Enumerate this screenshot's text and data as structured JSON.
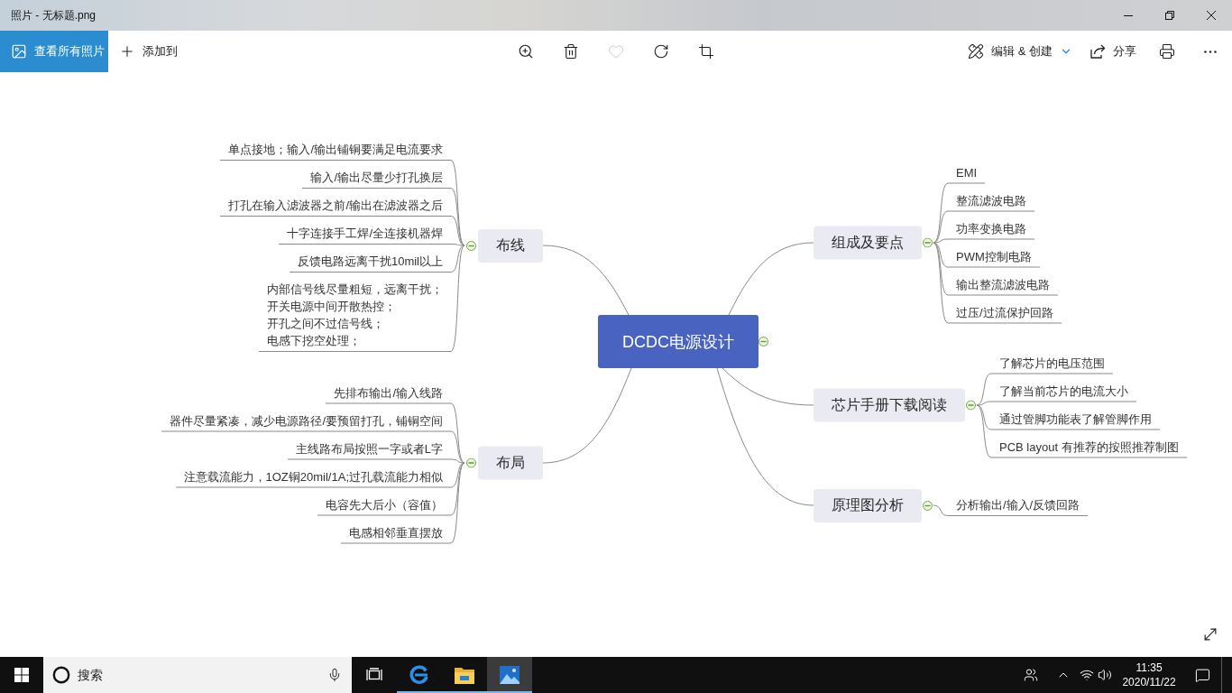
{
  "window": {
    "title": "照片 - 无标题.png"
  },
  "toolbar": {
    "view_all": "查看所有照片",
    "add_to": "添加到",
    "tools": [
      {
        "kind": "zoom",
        "disabled": false
      },
      {
        "kind": "delete",
        "disabled": false
      },
      {
        "kind": "favorite",
        "disabled": true
      },
      {
        "kind": "rotate",
        "disabled": false
      },
      {
        "kind": "crop",
        "disabled": false
      }
    ],
    "edit_create": "编辑 & 创建",
    "share": "分享"
  },
  "mindmap": {
    "central": {
      "label": "DCDC电源设计",
      "expanded": true
    },
    "left_branches": [
      {
        "label": "布线",
        "expanded": true,
        "children": [
          {
            "label": "单点接地；输入/输出铺铜要满足电流要求"
          },
          {
            "label": "输入/输出尽量少打孔换层"
          },
          {
            "label": "打孔在输入滤波器之前/输出在滤波器之后"
          },
          {
            "label": "十字连接手工焊/全连接机器焊"
          },
          {
            "label": "反馈电路远离干扰10mil以上"
          },
          {
            "lines": [
              "内部信号线尽量粗短，远离干扰；",
              "开关电源中间开散热控；",
              "开孔之间不过信号线；",
              "电感下挖空处理；"
            ]
          }
        ]
      },
      {
        "label": "布局",
        "expanded": true,
        "children": [
          {
            "label": "先排布输出/输入线路"
          },
          {
            "label": "器件尽量紧凑，减少电源路径/要预留打孔，铺铜空间"
          },
          {
            "label": "主线路布局按照一字或者L字"
          },
          {
            "label": "注意载流能力，1OZ铜20mil/1A;过孔载流能力相似"
          },
          {
            "label": "电容先大后小（容值）"
          },
          {
            "label": "电感相邻垂直摆放"
          }
        ]
      }
    ],
    "right_branches": [
      {
        "label": "组成及要点",
        "expanded": true,
        "children": [
          {
            "label": "EMI"
          },
          {
            "label": "整流滤波电路"
          },
          {
            "label": "功率变换电路"
          },
          {
            "label": "PWM控制电路"
          },
          {
            "label": "输出整流滤波电路"
          },
          {
            "label": "过压/过流保护回路"
          }
        ]
      },
      {
        "label": "芯片手册下载阅读",
        "expanded": true,
        "children": [
          {
            "label": "了解芯片的电压范围"
          },
          {
            "label": "了解当前芯片的电流大小"
          },
          {
            "label": "通过管脚功能表了解管脚作用"
          },
          {
            "label": "PCB layout 有推荐的按照推荐制图"
          }
        ]
      },
      {
        "label": "原理图分析",
        "expanded": true,
        "children": [
          {
            "label": "分析输出/输入/反馈回路"
          }
        ]
      }
    ]
  },
  "taskbar": {
    "search": {
      "placeholder": "搜索"
    },
    "apps": [
      {
        "kind": "edge",
        "running": true,
        "selected": false
      },
      {
        "kind": "explorer",
        "running": true,
        "selected": false
      },
      {
        "kind": "photos",
        "running": true,
        "selected": true
      }
    ],
    "time": "11:35",
    "date": "2020/11/22"
  }
}
